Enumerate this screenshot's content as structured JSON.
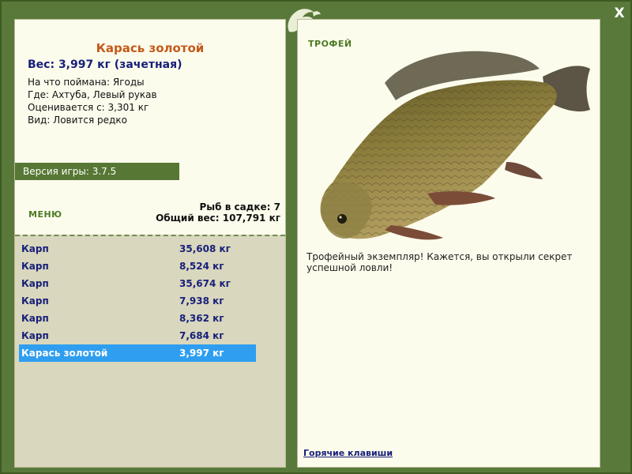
{
  "fish": {
    "name": "Карась золотой",
    "weight_line": "Вес: 3,997 кг (зачетная)",
    "bait_line": "На что поймана: Ягоды",
    "where_line": "Где: Ахтуба, Левый рукав",
    "rated_line": "Оценивается с: 3,301 кг",
    "kind_line": "Вид: Ловится редко"
  },
  "version": "Версия игры: 3.7.5",
  "menu_label": "МЕНЮ",
  "stats": {
    "count_line": "Рыб в садке: 7",
    "total_line": "Общий вес: 107,791 кг"
  },
  "catch_list": [
    {
      "name": "Карп",
      "weight": "35,608 кг"
    },
    {
      "name": "Карп",
      "weight": "8,524 кг"
    },
    {
      "name": "Карп",
      "weight": "35,674 кг"
    },
    {
      "name": "Карп",
      "weight": "7,938 кг"
    },
    {
      "name": "Карп",
      "weight": "8,362 кг"
    },
    {
      "name": "Карп",
      "weight": "7,684 кг"
    },
    {
      "name": "Карась золотой",
      "weight": "3,997 кг",
      "selected": true
    }
  ],
  "trophy": {
    "title": "ТРОФЕЙ",
    "text": "Трофейный экземпляр! Кажется, вы открыли секрет успешной ловли!"
  },
  "hotkeys_label": "Горячие клавиши",
  "close_label": "X",
  "icons": {
    "close": "close-icon",
    "logo": "fish-logo-icon"
  },
  "colors": {
    "frame": "#59793a",
    "panel": "#fcfced",
    "accent": "#577834",
    "selected": "#2f9ef0",
    "fish_name": "#c35a18",
    "link": "#18207a"
  }
}
